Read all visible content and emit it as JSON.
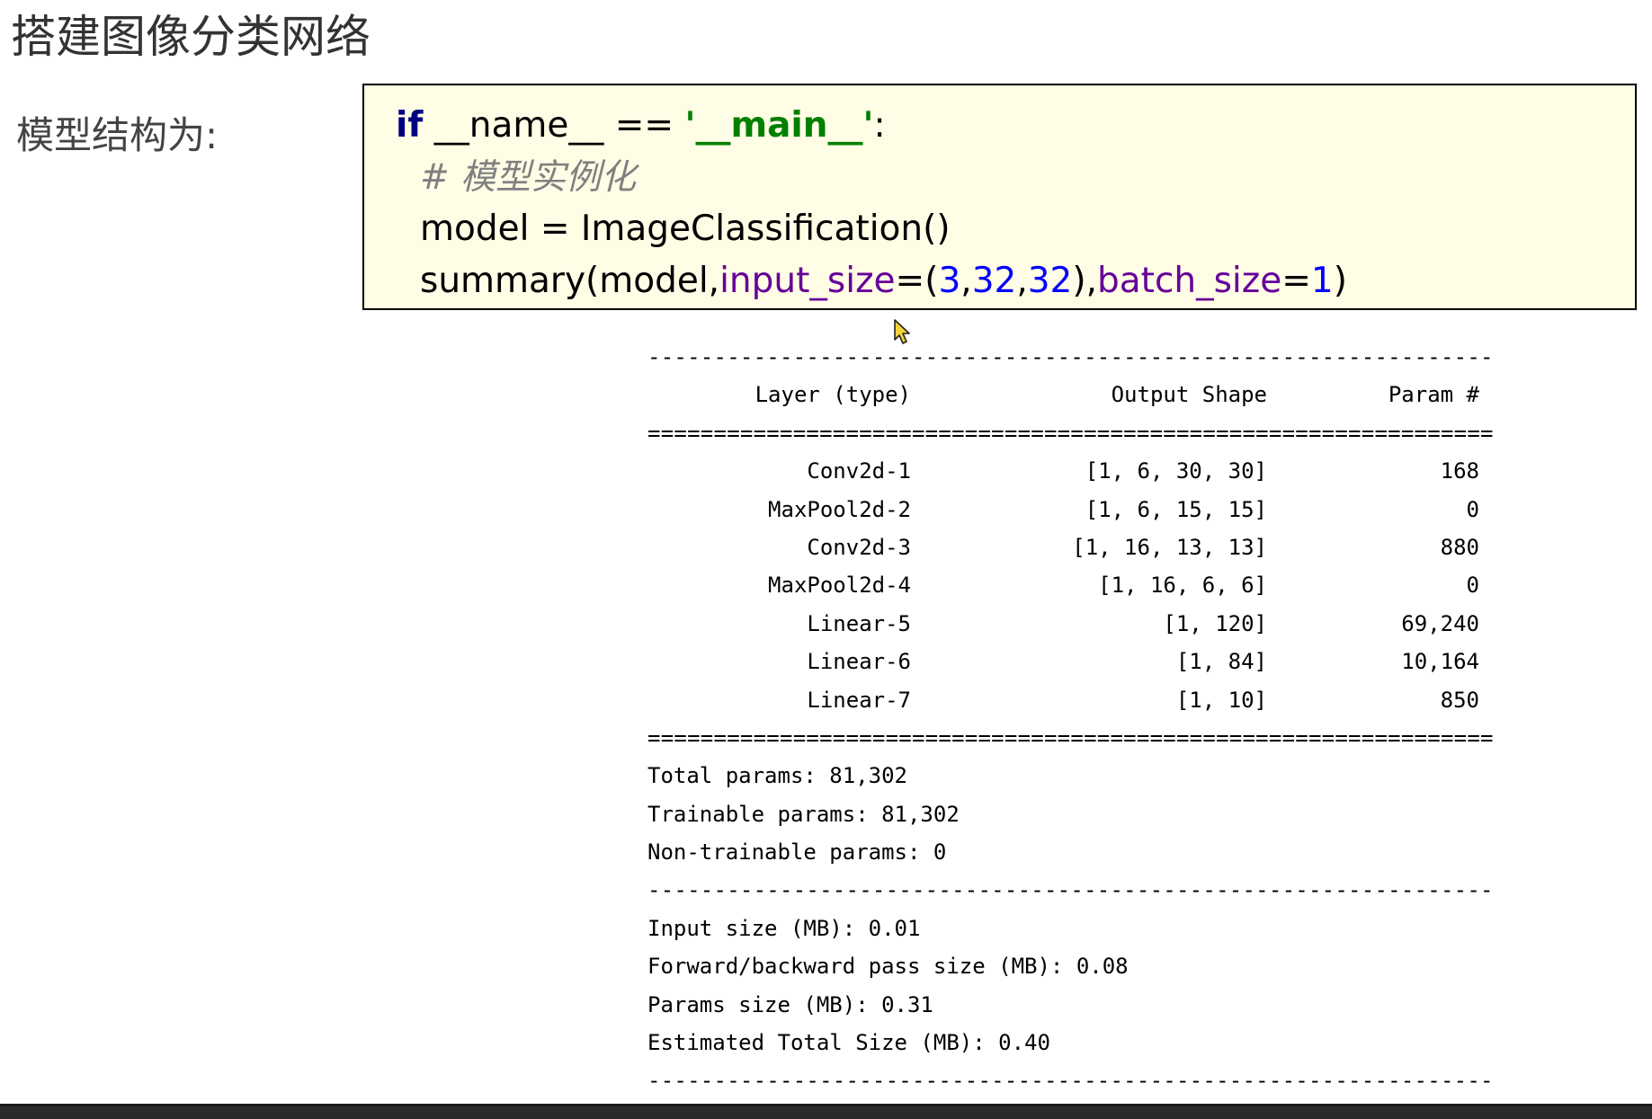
{
  "slide": {
    "title": "搭建图像分类网络",
    "side_label": "模型结构为:"
  },
  "code": {
    "line1": {
      "kw": "if",
      "mid": " __name__ == ",
      "str": "'__main__'",
      "end": ":"
    },
    "line2": {
      "comment": "# 模型实例化"
    },
    "line3": {
      "text": "model = ImageClassification()"
    },
    "line4": {
      "fn": "summary(model,",
      "p1": "input_size",
      "eq1": "=(",
      "n1": "3",
      "c1": ",",
      "n2": "32",
      "c2": ",",
      "n3": "32",
      "close1": "),",
      "p2": "batch_size",
      "eq2": "=",
      "n4": "1",
      "close2": ")"
    }
  },
  "summary": {
    "dash_rule": "----------------------------------------------------------------",
    "eq_rule": "================================================================",
    "headers": {
      "layer": "Layer (type)",
      "output": "Output Shape",
      "params": "Param #"
    },
    "rows": [
      {
        "layer": "Conv2d-1",
        "output": "[1, 6, 30, 30]",
        "params": "168"
      },
      {
        "layer": "MaxPool2d-2",
        "output": "[1, 6, 15, 15]",
        "params": "0"
      },
      {
        "layer": "Conv2d-3",
        "output": "[1, 16, 13, 13]",
        "params": "880"
      },
      {
        "layer": "MaxPool2d-4",
        "output": "[1, 16, 6, 6]",
        "params": "0"
      },
      {
        "layer": "Linear-5",
        "output": "[1, 120]",
        "params": "69,240"
      },
      {
        "layer": "Linear-6",
        "output": "[1, 84]",
        "params": "10,164"
      },
      {
        "layer": "Linear-7",
        "output": "[1, 10]",
        "params": "850"
      }
    ],
    "totals": {
      "total": "Total params: 81,302",
      "trainable": "Trainable params: 81,302",
      "non_trainable": "Non-trainable params: 0"
    },
    "sizes": {
      "input": "Input size (MB): 0.01",
      "forward_backward": "Forward/backward pass size (MB): 0.08",
      "params": "Params size (MB): 0.31",
      "total": "Estimated Total Size (MB): 0.40"
    }
  },
  "icons": {
    "cursor": "mouse-pointer-icon"
  },
  "colors": {
    "code_background": "#fffde5",
    "keyword": "#000080",
    "string": "#008000",
    "comment": "#808080",
    "parameter": "#660099",
    "number": "#0000ff"
  }
}
